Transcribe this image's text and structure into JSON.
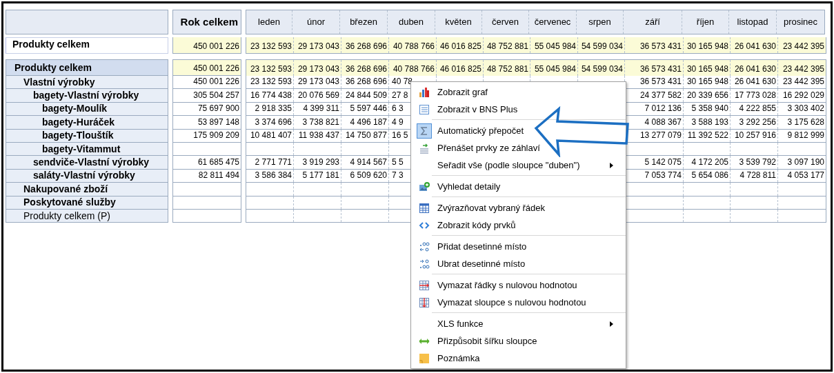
{
  "header": {
    "total_label": "Rok celkem",
    "months": [
      "leden",
      "únor",
      "březen",
      "duben",
      "květen",
      "červen",
      "červenec",
      "srpen",
      "září",
      "říjen",
      "listopad",
      "prosinec"
    ]
  },
  "summary": {
    "label": "Produkty celkem",
    "total": "450 001 226",
    "values": [
      "23 132 593",
      "29 173 043",
      "36 268 696",
      "40 788 766",
      "46 016 825",
      "48 752 881",
      "55 045 984",
      "54 599 034",
      "36 573 431",
      "30 165 948",
      "26 041 630",
      "23 442 395"
    ]
  },
  "rows": [
    {
      "label": "Produkty celkem",
      "kind": "total",
      "bold": true,
      "total": "450 001 226",
      "values": [
        "23 132 593",
        "29 173 043",
        "36 268 696",
        "40 788 766",
        "46 016 825",
        "48 752 881",
        "55 045 984",
        "54 599 034",
        "36 573 431",
        "30 165 948",
        "26 041 630",
        "23 442 395"
      ],
      "children": [
        {
          "label": "Vlastní výrobky",
          "kind": "item",
          "bold": true,
          "total": "450 001 226",
          "values": [
            "23 132 593",
            "29 173 043",
            "36 268 696",
            "40 78"
          ],
          "values_after_menu": [
            "36 573 431",
            "30 165 948",
            "26 041 630",
            "23 442 395"
          ],
          "children": [
            {
              "label": "bagety-Vlastní výrobky",
              "kind": "item",
              "bold": true,
              "total": "305 504 257",
              "values": [
                "16 774 438",
                "20 076 569",
                "24 844 509",
                "27 8"
              ],
              "values_after_menu": [
                "24 377 582",
                "20 339 656",
                "17 773 028",
                "16 292 029"
              ],
              "children": [
                {
                  "label": "bagety-Moulík",
                  "kind": "item",
                  "bold": true,
                  "total": "75 697 900",
                  "values": [
                    "2 918 335",
                    "4 399 311",
                    "5 597 446",
                    "6 3"
                  ],
                  "values_after_menu": [
                    "7 012 136",
                    "5 358 940",
                    "4 222 855",
                    "3 303 402"
                  ]
                },
                {
                  "label": "bagety-Huráček",
                  "kind": "item",
                  "bold": true,
                  "total": "53 897 148",
                  "values": [
                    "3 374 696",
                    "3 738 821",
                    "4 496 187",
                    "4 9"
                  ],
                  "values_after_menu": [
                    "4 088 367",
                    "3 588 193",
                    "3 292 256",
                    "3 175 628"
                  ]
                },
                {
                  "label": "bagety-Tlouštík",
                  "kind": "item",
                  "bold": true,
                  "total": "175 909 209",
                  "values": [
                    "10 481 407",
                    "11 938 437",
                    "14 750 877",
                    "16 5"
                  ],
                  "values_after_menu": [
                    "13 277 079",
                    "11 392 522",
                    "10 257 916",
                    "9 812 999"
                  ]
                },
                {
                  "label": "bagety-Vitammut",
                  "kind": "item",
                  "bold": true
                }
              ]
            },
            {
              "label": "sendviče-Vlastní výrobky",
              "kind": "item",
              "bold": true,
              "total": "61 685 475",
              "values": [
                "2 771 771",
                "3 919 293",
                "4 914 567",
                "5 5"
              ],
              "values_after_menu": [
                "5 142 075",
                "4 172 205",
                "3 539 792",
                "3 097 190"
              ]
            },
            {
              "label": "saláty-Vlastní výrobky",
              "kind": "item",
              "bold": true,
              "total": "82 811 494",
              "values": [
                "3 586 384",
                "5 177 181",
                "6 509 620",
                "7 3"
              ],
              "values_after_menu": [
                "7 053 774",
                "5 654 086",
                "4 728 811",
                "4 053 177"
              ]
            }
          ]
        },
        {
          "label": "Nakupované zboží",
          "kind": "item",
          "bold": true
        },
        {
          "label": "Poskytované služby",
          "kind": "item",
          "bold": true
        },
        {
          "label": "Produkty celkem (P)",
          "kind": "item",
          "bold": false
        }
      ]
    }
  ],
  "context_menu": {
    "groups": [
      [
        {
          "label": "Zobrazit graf",
          "kind": "chart",
          "checked": false,
          "submenu": false
        },
        {
          "label": "Zobrazit v BNS Plus",
          "kind": "list",
          "checked": false,
          "submenu": false
        }
      ],
      [
        {
          "label": "Automatický přepočet",
          "kind": "sigma",
          "checked": true,
          "submenu": false
        },
        {
          "label": "Přenášet prvky ze záhlaví",
          "kind": "transfer",
          "checked": false,
          "submenu": false
        },
        {
          "label": "Seřadit vše (podle sloupce \"duben\")",
          "kind": "plain",
          "checked": false,
          "submenu": true
        }
      ],
      [
        {
          "label": "Vyhledat detaily",
          "kind": "details",
          "checked": false,
          "submenu": false
        }
      ],
      [
        {
          "label": "Zvýrazňovat vybraný řádek",
          "kind": "table",
          "checked": false,
          "submenu": false
        },
        {
          "label": "Zobrazit kódy prvků",
          "kind": "code",
          "checked": false,
          "submenu": false
        }
      ],
      [
        {
          "label": "Přidat desetinné místo",
          "kind": "dec_add",
          "checked": false,
          "submenu": false
        },
        {
          "label": "Ubrat desetinné místo",
          "kind": "dec_remove",
          "checked": false,
          "submenu": false
        }
      ],
      [
        {
          "label": "Vymazat řádky s nulovou hodnotou",
          "kind": "del_rows",
          "checked": false,
          "submenu": false
        },
        {
          "label": "Vymazat sloupce s nulovou hodnotou",
          "kind": "del_cols",
          "checked": false,
          "submenu": false
        }
      ],
      [
        {
          "label": "XLS funkce",
          "kind": "plain",
          "checked": false,
          "submenu": true
        },
        {
          "label": "Přizpůsobit šířku sloupce",
          "kind": "fit",
          "checked": false,
          "submenu": false
        },
        {
          "label": "Poznámka",
          "kind": "note",
          "checked": false,
          "submenu": false
        }
      ]
    ]
  }
}
